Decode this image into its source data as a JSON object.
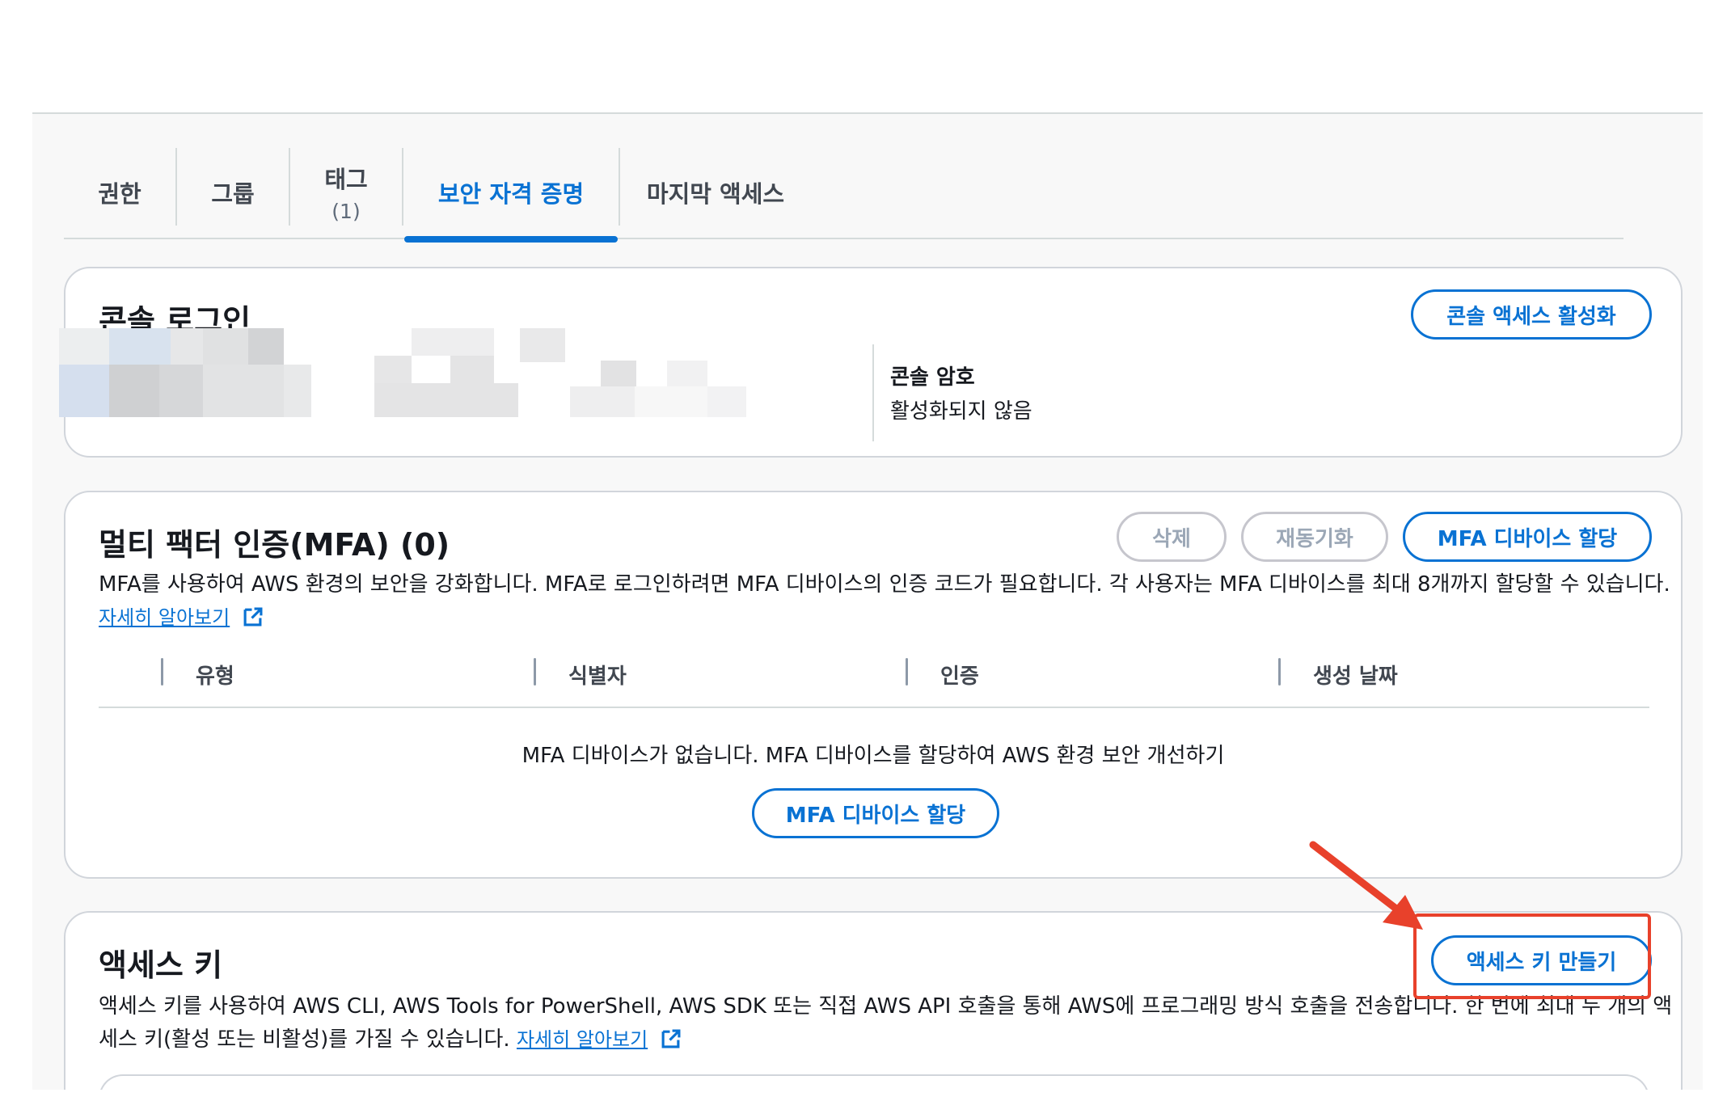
{
  "tabs": [
    {
      "label": "권한",
      "sub": ""
    },
    {
      "label": "그룹",
      "sub": ""
    },
    {
      "label": "태그",
      "sub": "(1)"
    },
    {
      "label": "보안 자격 증명",
      "sub": "",
      "active": true
    },
    {
      "label": "마지막 액세스",
      "sub": ""
    }
  ],
  "console_login": {
    "title": "콘솔 로그인",
    "enable_button": "콘솔 액세스 활성화",
    "password_label": "콘솔 암호",
    "password_value": "활성화되지 않음"
  },
  "mfa": {
    "title": "멀티 팩터 인증(MFA) (0)",
    "delete_button": "삭제",
    "resync_button": "재동기화",
    "assign_button": "MFA 디바이스 할당",
    "description": "MFA를 사용하여 AWS 환경의 보안을 강화합니다. MFA로 로그인하려면 MFA 디바이스의 인증 코드가 필요합니다. 각 사용자는 MFA 디바이스를 최대 8개까지 할당할 수 있습니다.",
    "learn_more": "자세히 알아보기",
    "columns": [
      "유형",
      "식별자",
      "인증",
      "생성 날짜"
    ],
    "empty_message": "MFA 디바이스가 없습니다. MFA 디바이스를 할당하여 AWS 환경 보안 개선하기",
    "empty_assign_button": "MFA 디바이스 할당"
  },
  "access_keys": {
    "title": "액세스 키",
    "create_button": "액세스 키 만들기",
    "description": "액세스 키를 사용하여 AWS CLI, AWS Tools for PowerShell, AWS SDK 또는 직접 AWS API 호출을 통해 AWS에 프로그래밍 방식 호출을 전송합니다. 한 번에 최대 두 개의 액세스 키(활성 또는 비활성)를 가질 수 있습니다.",
    "learn_more": "자세히 알아보기"
  },
  "colors": {
    "accent": "#0972d3",
    "annotation": "#e8412b",
    "border": "#d1d5db"
  }
}
